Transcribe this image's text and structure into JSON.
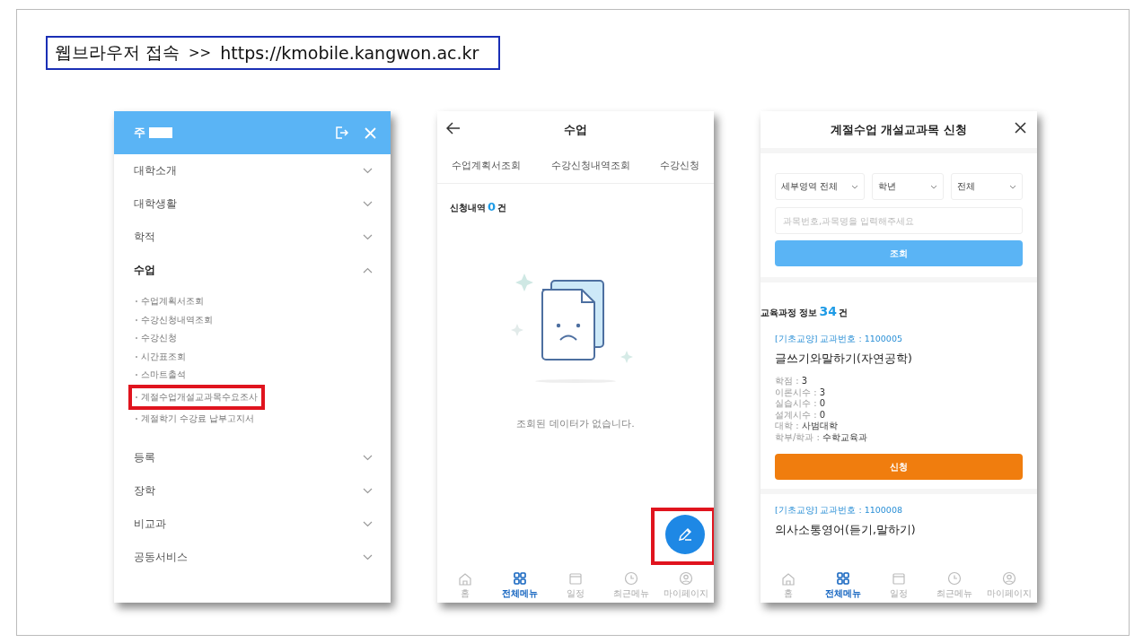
{
  "instruction": {
    "label": "웹브라우저 접속",
    "arrow": ">>",
    "url": "https://kmobile.kangwon.ac.kr"
  },
  "menu_screen": {
    "user_initial": "주",
    "items": [
      {
        "label": "대학소개",
        "expanded": false
      },
      {
        "label": "대학생활",
        "expanded": false
      },
      {
        "label": "학적",
        "expanded": false
      },
      {
        "label": "수업",
        "expanded": true,
        "children": [
          {
            "label": "수업계획서조회",
            "highlighted": false
          },
          {
            "label": "수강신청내역조회",
            "highlighted": false
          },
          {
            "label": "수강신청",
            "highlighted": false
          },
          {
            "label": "시간표조회",
            "highlighted": false
          },
          {
            "label": "스마트출석",
            "highlighted": false
          },
          {
            "label": "계절수업개설교과목수요조사",
            "highlighted": true
          },
          {
            "label": "계절학기 수강료 납부고지서",
            "highlighted": false
          }
        ]
      },
      {
        "label": "등록",
        "expanded": false
      },
      {
        "label": "장학",
        "expanded": false
      },
      {
        "label": "비교과",
        "expanded": false
      },
      {
        "label": "공동서비스",
        "expanded": false
      }
    ]
  },
  "class_screen": {
    "title": "수업",
    "tabs": [
      "수업계획서조회",
      "수강신청내역조회",
      "수강신청"
    ],
    "count": {
      "label": "신청내역",
      "value": "0",
      "unit": "건"
    },
    "empty_message": "조회된 데이터가 없습니다.",
    "fab_highlighted": true,
    "nav": [
      {
        "label": "홈",
        "kind": "home",
        "selected": false
      },
      {
        "label": "전체메뉴",
        "kind": "grid",
        "selected": true
      },
      {
        "label": "일정",
        "kind": "calendar",
        "selected": false
      },
      {
        "label": "최근메뉴",
        "kind": "clock",
        "selected": false
      },
      {
        "label": "마이페이지",
        "kind": "user",
        "selected": false
      }
    ]
  },
  "apply_screen": {
    "title": "계절수업 개설교과목 신청",
    "filters": [
      "세부영역 전체",
      "학년",
      "전체"
    ],
    "search_placeholder": "과목번호,과목명을 입력해주세요",
    "search_button": "조회",
    "count": {
      "label": "교육과정 정보",
      "value": "34",
      "unit": "건"
    },
    "courses": [
      {
        "category": "[기초교양] 교과번호 : 1100005",
        "name": "글쓰기와말하기(자연공학)",
        "details": [
          {
            "key": "학점 :",
            "value": "3"
          },
          {
            "key": "이론시수 :",
            "value": "3"
          },
          {
            "key": "실습시수 :",
            "value": "0"
          },
          {
            "key": "설계시수 :",
            "value": "0"
          },
          {
            "key": "대학 :",
            "value": "사범대학"
          },
          {
            "key": "학부/학과 :",
            "value": "수학교육과"
          }
        ],
        "apply_button": "신청"
      },
      {
        "category": "[기초교양] 교과번호 : 1100008",
        "name": "의사소통영어(듣기,말하기)"
      }
    ],
    "nav": [
      {
        "label": "홈",
        "kind": "home",
        "selected": false
      },
      {
        "label": "전체메뉴",
        "kind": "grid",
        "selected": true
      },
      {
        "label": "일정",
        "kind": "calendar",
        "selected": false
      },
      {
        "label": "최근메뉴",
        "kind": "clock",
        "selected": false
      },
      {
        "label": "마이페이지",
        "kind": "user",
        "selected": false
      }
    ]
  }
}
